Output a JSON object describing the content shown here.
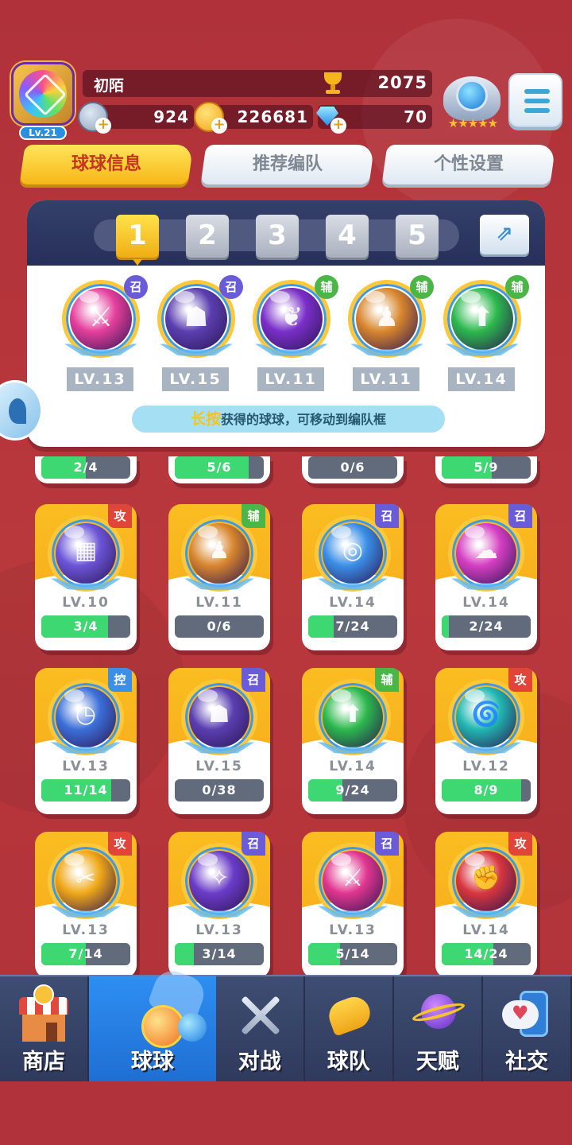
{
  "player": {
    "name": "初陌",
    "level_badge": "Lv.21",
    "trophies": "2075",
    "silver": "924",
    "gold": "226681",
    "diamonds": "70",
    "rank_stars": "★★★★★"
  },
  "tabs": [
    {
      "label": "球球信息",
      "active": true
    },
    {
      "label": "推荐编队",
      "active": false
    },
    {
      "label": "个性设置",
      "active": false
    }
  ],
  "formation": {
    "slots": [
      "1",
      "2",
      "3",
      "4",
      "5"
    ],
    "selected_slot": "1",
    "share_icon": "share-icon",
    "balls": [
      {
        "level": "LV.13",
        "tag": "召",
        "color": "#e43f9c",
        "glyph": "⚔"
      },
      {
        "level": "LV.15",
        "tag": "召",
        "color": "#5a3fb0",
        "glyph": "☗"
      },
      {
        "level": "LV.11",
        "tag": "辅",
        "color": "#7a2fc8",
        "glyph": "❦"
      },
      {
        "level": "LV.11",
        "tag": "辅",
        "color": "#d8862e",
        "glyph": "♟"
      },
      {
        "level": "LV.14",
        "tag": "辅",
        "color": "#2cb84d",
        "glyph": "⬆"
      }
    ],
    "hint_highlight": "长按",
    "hint_text": "获得的球球，可移动到编队框"
  },
  "partial_row": [
    "2/4",
    "5/6",
    "0/6",
    "5/9"
  ],
  "partial_row_progress": [
    0.5,
    0.83,
    0.0,
    0.56
  ],
  "cards": [
    {
      "level": "LV.10",
      "progress": "3/4",
      "ratio": 0.75,
      "tag": "攻",
      "color": "#6b55d8",
      "glyph": "▦"
    },
    {
      "level": "LV.11",
      "progress": "0/6",
      "ratio": 0.0,
      "tag": "辅",
      "color": "#d8862e",
      "glyph": "♟"
    },
    {
      "level": "LV.14",
      "progress": "7/24",
      "ratio": 0.29,
      "tag": "召",
      "color": "#3a8ee6",
      "glyph": "◎"
    },
    {
      "level": "LV.14",
      "progress": "2/24",
      "ratio": 0.08,
      "tag": "召",
      "color": "#d43fc2",
      "glyph": "☁"
    },
    {
      "level": "LV.13",
      "progress": "11/14",
      "ratio": 0.79,
      "tag": "控",
      "color": "#3b6fd8",
      "glyph": "◷"
    },
    {
      "level": "LV.15",
      "progress": "0/38",
      "ratio": 0.0,
      "tag": "召",
      "color": "#5a3fb0",
      "glyph": "☗"
    },
    {
      "level": "LV.14",
      "progress": "9/24",
      "ratio": 0.38,
      "tag": "辅",
      "color": "#2cb84d",
      "glyph": "⬆"
    },
    {
      "level": "LV.12",
      "progress": "8/9",
      "ratio": 0.89,
      "tag": "攻",
      "color": "#21b6b0",
      "glyph": "🌀"
    },
    {
      "level": "LV.13",
      "progress": "7/14",
      "ratio": 0.5,
      "tag": "攻",
      "color": "#f0a818",
      "glyph": "✂"
    },
    {
      "level": "LV.13",
      "progress": "3/14",
      "ratio": 0.21,
      "tag": "召",
      "color": "#6b3cc8",
      "glyph": "✧"
    },
    {
      "level": "LV.13",
      "progress": "5/14",
      "ratio": 0.36,
      "tag": "召",
      "color": "#e0368f",
      "glyph": "⚔"
    },
    {
      "level": "LV.14",
      "progress": "14/24",
      "ratio": 0.58,
      "tag": "攻",
      "color": "#d8363e",
      "glyph": "✊"
    }
  ],
  "nav": [
    {
      "label": "商店",
      "icon": "shop-icon",
      "active": false
    },
    {
      "label": "球球",
      "icon": "ball-icon",
      "active": true
    },
    {
      "label": "对战",
      "icon": "swords-icon",
      "active": false
    },
    {
      "label": "球队",
      "icon": "whistle-icon",
      "active": false
    },
    {
      "label": "天赋",
      "icon": "planet-icon",
      "active": false
    },
    {
      "label": "社交",
      "icon": "chat-icon",
      "active": false
    }
  ]
}
